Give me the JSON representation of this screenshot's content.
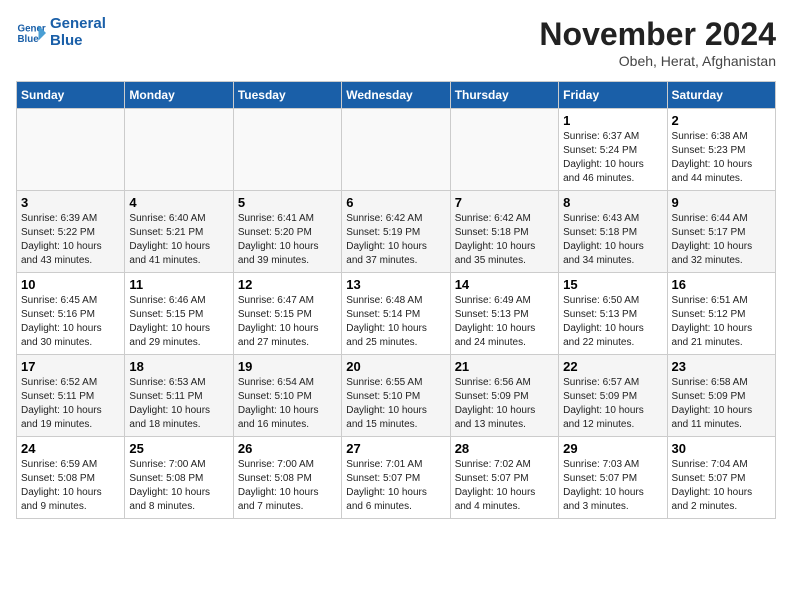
{
  "header": {
    "logo_line1": "General",
    "logo_line2": "Blue",
    "title": "November 2024",
    "subtitle": "Obeh, Herat, Afghanistan"
  },
  "weekdays": [
    "Sunday",
    "Monday",
    "Tuesday",
    "Wednesday",
    "Thursday",
    "Friday",
    "Saturday"
  ],
  "weeks": [
    [
      {
        "day": "",
        "info": ""
      },
      {
        "day": "",
        "info": ""
      },
      {
        "day": "",
        "info": ""
      },
      {
        "day": "",
        "info": ""
      },
      {
        "day": "",
        "info": ""
      },
      {
        "day": "1",
        "info": "Sunrise: 6:37 AM\nSunset: 5:24 PM\nDaylight: 10 hours\nand 46 minutes."
      },
      {
        "day": "2",
        "info": "Sunrise: 6:38 AM\nSunset: 5:23 PM\nDaylight: 10 hours\nand 44 minutes."
      }
    ],
    [
      {
        "day": "3",
        "info": "Sunrise: 6:39 AM\nSunset: 5:22 PM\nDaylight: 10 hours\nand 43 minutes."
      },
      {
        "day": "4",
        "info": "Sunrise: 6:40 AM\nSunset: 5:21 PM\nDaylight: 10 hours\nand 41 minutes."
      },
      {
        "day": "5",
        "info": "Sunrise: 6:41 AM\nSunset: 5:20 PM\nDaylight: 10 hours\nand 39 minutes."
      },
      {
        "day": "6",
        "info": "Sunrise: 6:42 AM\nSunset: 5:19 PM\nDaylight: 10 hours\nand 37 minutes."
      },
      {
        "day": "7",
        "info": "Sunrise: 6:42 AM\nSunset: 5:18 PM\nDaylight: 10 hours\nand 35 minutes."
      },
      {
        "day": "8",
        "info": "Sunrise: 6:43 AM\nSunset: 5:18 PM\nDaylight: 10 hours\nand 34 minutes."
      },
      {
        "day": "9",
        "info": "Sunrise: 6:44 AM\nSunset: 5:17 PM\nDaylight: 10 hours\nand 32 minutes."
      }
    ],
    [
      {
        "day": "10",
        "info": "Sunrise: 6:45 AM\nSunset: 5:16 PM\nDaylight: 10 hours\nand 30 minutes."
      },
      {
        "day": "11",
        "info": "Sunrise: 6:46 AM\nSunset: 5:15 PM\nDaylight: 10 hours\nand 29 minutes."
      },
      {
        "day": "12",
        "info": "Sunrise: 6:47 AM\nSunset: 5:15 PM\nDaylight: 10 hours\nand 27 minutes."
      },
      {
        "day": "13",
        "info": "Sunrise: 6:48 AM\nSunset: 5:14 PM\nDaylight: 10 hours\nand 25 minutes."
      },
      {
        "day": "14",
        "info": "Sunrise: 6:49 AM\nSunset: 5:13 PM\nDaylight: 10 hours\nand 24 minutes."
      },
      {
        "day": "15",
        "info": "Sunrise: 6:50 AM\nSunset: 5:13 PM\nDaylight: 10 hours\nand 22 minutes."
      },
      {
        "day": "16",
        "info": "Sunrise: 6:51 AM\nSunset: 5:12 PM\nDaylight: 10 hours\nand 21 minutes."
      }
    ],
    [
      {
        "day": "17",
        "info": "Sunrise: 6:52 AM\nSunset: 5:11 PM\nDaylight: 10 hours\nand 19 minutes."
      },
      {
        "day": "18",
        "info": "Sunrise: 6:53 AM\nSunset: 5:11 PM\nDaylight: 10 hours\nand 18 minutes."
      },
      {
        "day": "19",
        "info": "Sunrise: 6:54 AM\nSunset: 5:10 PM\nDaylight: 10 hours\nand 16 minutes."
      },
      {
        "day": "20",
        "info": "Sunrise: 6:55 AM\nSunset: 5:10 PM\nDaylight: 10 hours\nand 15 minutes."
      },
      {
        "day": "21",
        "info": "Sunrise: 6:56 AM\nSunset: 5:09 PM\nDaylight: 10 hours\nand 13 minutes."
      },
      {
        "day": "22",
        "info": "Sunrise: 6:57 AM\nSunset: 5:09 PM\nDaylight: 10 hours\nand 12 minutes."
      },
      {
        "day": "23",
        "info": "Sunrise: 6:58 AM\nSunset: 5:09 PM\nDaylight: 10 hours\nand 11 minutes."
      }
    ],
    [
      {
        "day": "24",
        "info": "Sunrise: 6:59 AM\nSunset: 5:08 PM\nDaylight: 10 hours\nand 9 minutes."
      },
      {
        "day": "25",
        "info": "Sunrise: 7:00 AM\nSunset: 5:08 PM\nDaylight: 10 hours\nand 8 minutes."
      },
      {
        "day": "26",
        "info": "Sunrise: 7:00 AM\nSunset: 5:08 PM\nDaylight: 10 hours\nand 7 minutes."
      },
      {
        "day": "27",
        "info": "Sunrise: 7:01 AM\nSunset: 5:07 PM\nDaylight: 10 hours\nand 6 minutes."
      },
      {
        "day": "28",
        "info": "Sunrise: 7:02 AM\nSunset: 5:07 PM\nDaylight: 10 hours\nand 4 minutes."
      },
      {
        "day": "29",
        "info": "Sunrise: 7:03 AM\nSunset: 5:07 PM\nDaylight: 10 hours\nand 3 minutes."
      },
      {
        "day": "30",
        "info": "Sunrise: 7:04 AM\nSunset: 5:07 PM\nDaylight: 10 hours\nand 2 minutes."
      }
    ]
  ]
}
